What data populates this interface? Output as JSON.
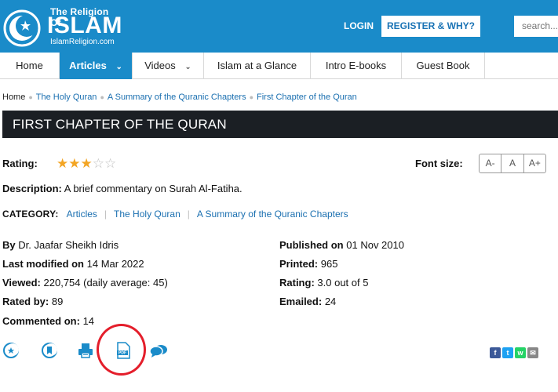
{
  "header": {
    "logo_small": "The Religion Of",
    "logo_big": "ISLAM",
    "logo_url": "IslamReligion.com",
    "login": "LOGIN",
    "register": "REGISTER & WHY?",
    "search_placeholder": "search..."
  },
  "nav": {
    "items": [
      {
        "label": "Home"
      },
      {
        "label": "Articles"
      },
      {
        "label": "Videos"
      },
      {
        "label": "Islam at a Glance"
      },
      {
        "label": "Intro E-books"
      },
      {
        "label": "Guest Book"
      }
    ],
    "active_index": 1
  },
  "breadcrumb": {
    "home": "Home",
    "items": [
      "The Holy Quran",
      "A Summary of the Quranic Chapters",
      "First Chapter of the Quran"
    ]
  },
  "article": {
    "title": "FIRST CHAPTER OF THE QURAN",
    "rating_label": "Rating:",
    "rating_stars": 3,
    "rating_max": 5,
    "font_size_label": "Font size:",
    "font_buttons": [
      "A-",
      "A",
      "A+"
    ],
    "description_label": "Description:",
    "description": "A brief commentary on Surah Al-Fatiha.",
    "category_label": "CATEGORY:",
    "categories": [
      "Articles",
      "The Holy Quran",
      "A Summary of the Quranic Chapters"
    ]
  },
  "meta": {
    "by_label": "By",
    "by": "Dr. Jaafar Sheikh Idris",
    "last_modified_label": "Last modified on",
    "last_modified": "14 Mar 2022",
    "viewed_label": "Viewed:",
    "viewed": "220,754 (daily average: 45)",
    "rated_by_label": "Rated by:",
    "rated_by": "89",
    "commented_label": "Commented on:",
    "commented": "14",
    "published_label": "Published on",
    "published": "01 Nov 2010",
    "printed_label": "Printed:",
    "printed": "965",
    "rating_label": "Rating:",
    "rating": "3.0 out of 5",
    "emailed_label": "Emailed:",
    "emailed": "24"
  },
  "icons": {
    "pdf_text": "PDF"
  },
  "colors": {
    "brand_blue": "#1a8bc9",
    "title_bar": "#1b1f24",
    "link": "#1a6fb0",
    "star": "#f3a524",
    "highlight_circle": "#e41e2b"
  }
}
